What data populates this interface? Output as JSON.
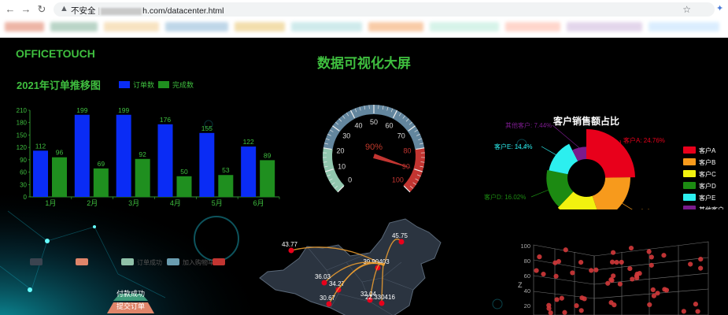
{
  "browser": {
    "security_label": "不安全",
    "url_suffix": "h.com/datacenter.html",
    "back_icon": "arrow-left-icon",
    "forward_icon": "arrow-right-icon",
    "reload_icon": "reload-icon",
    "star_icon": "star-icon"
  },
  "page": {
    "brand": "OFFICETOUCH",
    "title": "数据可视化大屏"
  },
  "colors": {
    "accent": "#3fbf3f",
    "bar_blue": "#0a2cf5",
    "bar_green": "#1f8f1f"
  },
  "chart_data": [
    {
      "type": "bar",
      "title": "2021年订单推移图",
      "categories": [
        "1月",
        "2月",
        "3月",
        "4月",
        "5月",
        "6月"
      ],
      "series": [
        {
          "name": "订单数",
          "values": [
            112,
            199,
            199,
            176,
            155,
            122
          ]
        },
        {
          "name": "完成数",
          "values": [
            96,
            69,
            92,
            50,
            53,
            89
          ]
        }
      ],
      "yticks": [
        "0",
        "30",
        "60",
        "90",
        "120",
        "150",
        "180",
        "210"
      ],
      "ylim": [
        0,
        210
      ]
    },
    {
      "type": "gauge",
      "value": 90,
      "value_label": "90%",
      "ticks": [
        "0",
        "10",
        "20",
        "30",
        "40",
        "50",
        "60",
        "70",
        "80",
        "90",
        "100"
      ],
      "range": [
        0,
        100
      ]
    },
    {
      "type": "pie",
      "title": "客户销售额占比",
      "slices": [
        {
          "name": "客户A",
          "value": 24.76,
          "label": "客户A: 24.76%",
          "color": "#e8001b"
        },
        {
          "name": "客户B",
          "value": 20.07,
          "label": "客户B: 20.07%",
          "color": "#f79a1c"
        },
        {
          "name": "客户C",
          "value": 17.31,
          "label": "客户C: 17.31%",
          "color": "#f2f20f"
        },
        {
          "name": "客户D",
          "value": 16.02,
          "label": "客户D: 16.02%",
          "color": "#1c8a12"
        },
        {
          "name": "客户E",
          "value": 14.4,
          "label": "客户E: 14.4%",
          "color": "#2cefef"
        },
        {
          "name": "其他客户",
          "value": 7.44,
          "label": "其他客户: 7.44%",
          "color": "#7a1b8c"
        }
      ]
    },
    {
      "type": "map",
      "labels": [
        "43.77",
        "45.75",
        "39.90403",
        "36.03",
        "34.27",
        "32.04",
        "30.67",
        "22.330416"
      ]
    },
    {
      "type": "funnel",
      "legend": [
        "",
        "",
        "订单成功",
        "加入购物车",
        ""
      ],
      "stages": [
        "付款成功",
        "提交订单"
      ]
    },
    {
      "type": "scatter3d",
      "axis_label": "Z",
      "zticks": [
        "100",
        "80",
        "60",
        "40",
        "20"
      ]
    }
  ]
}
